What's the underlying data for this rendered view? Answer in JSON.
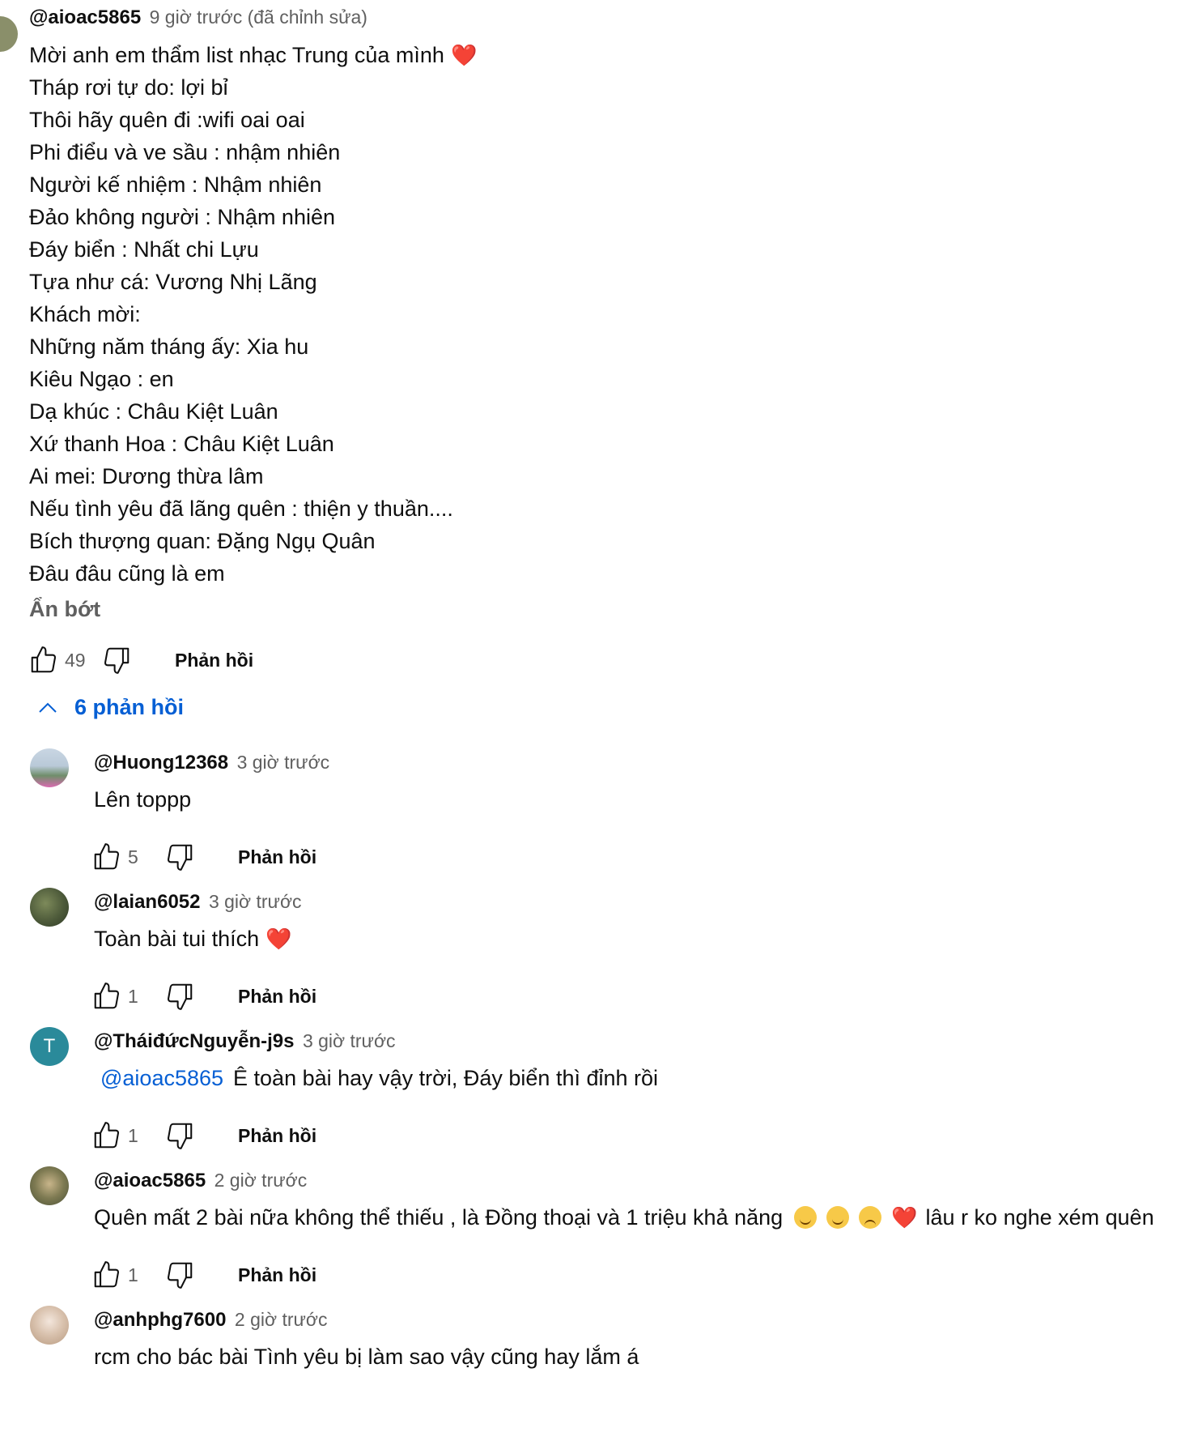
{
  "main_comment": {
    "author": "@aioac5865",
    "time": "9 giờ trước (đã chỉnh sửa)",
    "lines": [
      "Mời anh em thẩm list nhạc Trung của mình",
      "Tháp rơi tự do: lợi bỉ",
      "Thôi hãy quên đi :wifi oai oai",
      "Phi điểu và ve sầu : nhậm nhiên",
      "Người kế nhiệm : Nhậm nhiên",
      "Đảo không người : Nhậm nhiên",
      "Đáy biển : Nhất chi Lựu",
      "Tựa như cá: Vương Nhị Lãng",
      "Khách mời:",
      "Những năm tháng ấy: Xia hu",
      "Kiêu Ngạo : en",
      "Dạ khúc : Châu Kiệt Luân",
      "Xứ thanh Hoa : Châu Kiệt Luân",
      "Ai mei: Dương thừa lâm",
      "Nếu tình yêu đã lãng quên : thiện y thuần....",
      "Bích thượng quan: Đặng Ngụ Quân",
      "Đâu đâu cũng là em"
    ],
    "first_line_emoji": "❤️",
    "show_less": "Ẩn bớt",
    "likes": "49",
    "reply_label": "Phản hồi",
    "heart_color": "#e0245e"
  },
  "replies_toggle": {
    "label": "6 phản hồi",
    "color": "#065fd4"
  },
  "replies": [
    {
      "author": "@Huong12368",
      "time": "3 giờ trước",
      "text": "Lên toppp",
      "likes": "5",
      "reply_label": "Phản hồi"
    },
    {
      "author": "@laian6052",
      "time": "3 giờ trước",
      "text": "Toàn bài tui thích",
      "likes": "1",
      "reply_label": "Phản hồi"
    },
    {
      "author": "@TháiđứcNguyễn-j9s",
      "time": "3 giờ trước",
      "avatar_letter": "T",
      "avatar_color": "#2a8a9a",
      "mention": "@aioac5865",
      "text": "Ê toàn bài hay vậy trời,  Đáy biển thì đỉnh rồi",
      "likes": "1",
      "reply_label": "Phản hồi"
    },
    {
      "author": "@aioac5865",
      "time": "2 giờ trước",
      "text": "Quên mất 2 bài nữa không thể thiếu , là Đồng thoại và 1 triệu khả năng",
      "text_after": "lâu r ko nghe xém quên",
      "likes": "1",
      "reply_label": "Phản hồi"
    },
    {
      "author": "@anhphg7600",
      "time": "2 giờ trước",
      "text": "rcm cho bác bài Tình yêu bị làm sao vậy cũng hay lắm á"
    }
  ]
}
